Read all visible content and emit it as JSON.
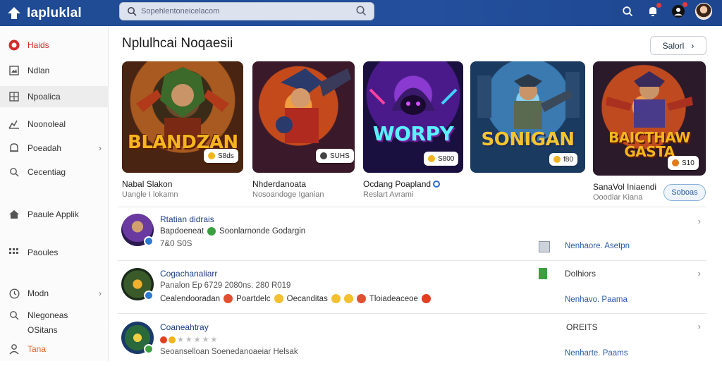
{
  "app": {
    "title": "Iapluklal"
  },
  "search": {
    "placeholder": "Sopehlentoneicelacom"
  },
  "sidebar": {
    "items": [
      {
        "label": "Haids",
        "icon": "circle-badge-icon"
      },
      {
        "label": "Ndlan",
        "icon": "image-icon"
      },
      {
        "label": "Npoalica",
        "icon": "grid-icon"
      },
      {
        "label": "Noonoleal",
        "icon": "chart-icon"
      },
      {
        "label": "Poeadah",
        "icon": "bell-icon"
      },
      {
        "label": "Cecentiag",
        "icon": "search-icon"
      },
      {
        "label": "Paaule Applik",
        "icon": "home-icon"
      },
      {
        "label": "Paoules",
        "icon": "dots-grid-icon"
      },
      {
        "label": "Modn",
        "icon": "clock-icon"
      },
      {
        "label": "Nlegoneas",
        "icon": "search-icon"
      },
      {
        "label": "OSitans",
        "icon": ""
      },
      {
        "label": "Tana",
        "icon": "person-icon"
      }
    ]
  },
  "section": {
    "title": "Nplulhcai Noqaesii",
    "more_label": "Salorl"
  },
  "cards": [
    {
      "art_title": "BLANDZAN",
      "price": "S8ds",
      "name": "Nabal Slakon",
      "sub": "Uangle I lokamn"
    },
    {
      "art_title": "",
      "price": "SUHS",
      "name": "Nhderdanoata",
      "sub": "Nosoandoge Iganian"
    },
    {
      "art_title": "WORPY",
      "price": "S800",
      "name": "Ocdang Poapland",
      "sub": "Reslart Avrami"
    },
    {
      "art_title": "SONIGAN",
      "price": "f80",
      "name": "",
      "sub": ""
    },
    {
      "art_title": "BAICTHAW GASTA",
      "price": "S10",
      "name": "SanaVol Iniaendi",
      "sub": "Ooodiar Kiana",
      "button": "Soboas"
    }
  ],
  "rows": [
    {
      "title": "Rtatian didrais",
      "line1a": "Bapdoeneat",
      "line1b": "Soonlarnonde Godargin",
      "line2": "7&0 S0S",
      "right_link": "Nenhaore. Asetpn"
    },
    {
      "title": "Cogachanaliarr",
      "line1": "Panalon Ep 6729 2080ns. 280 R019",
      "line2a": "Cealendooradan",
      "line2b": "Poartdelc",
      "line2c": "Oecanditas",
      "line2d": "Tloiadeaceoe",
      "right_label": "Dolhiors",
      "right_link": "Nenhavo. Paama"
    },
    {
      "title": "Coaneahtray",
      "line2": "Seoanselloan Soenedanoaeiar Helsak",
      "right_label": "OREITS",
      "right_link": "Nenharte. Paams"
    }
  ],
  "colors": {
    "topbar": "#234f9c",
    "accent_red": "#d42b2b",
    "link_blue": "#2a5ea8",
    "orange": "#e1641c"
  }
}
